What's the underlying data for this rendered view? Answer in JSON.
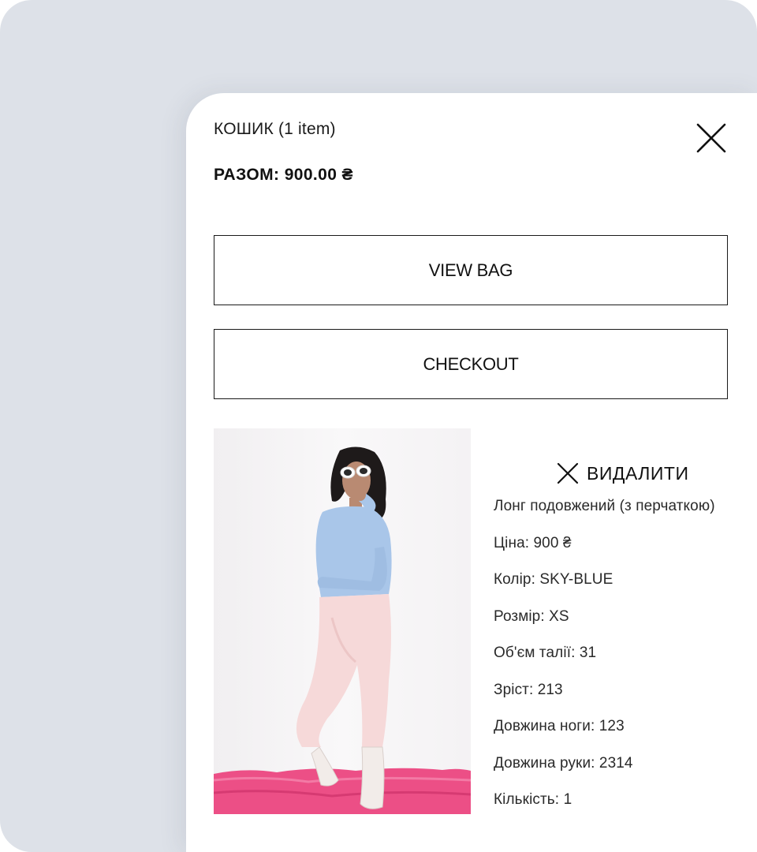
{
  "cart": {
    "title": "КОШИК (1 item)",
    "total_label": "РАЗОМ:",
    "total_value": "900.00 ₴",
    "close_icon": "close-icon"
  },
  "actions": {
    "view_bag": "VIEW BAG",
    "checkout": "CHECKOUT"
  },
  "item": {
    "remove_label": "ВИДАЛИТИ",
    "name": "Лонг подовжений (з перчаткою)",
    "price": "Ціна: 900 ₴",
    "color": "Колір: SKY-BLUE",
    "size": "Розмір: XS",
    "waist": "Об'єм талії: 31",
    "height": "Зріст: 213",
    "leg_length": "Довжина ноги: 123",
    "arm_length": "Довжина руки: 2314",
    "quantity": "Кількість: 1"
  },
  "colors": {
    "backdrop": "#dde1e8",
    "panel": "#ffffff",
    "border": "#1a1a1a",
    "top_garment": "#a9c6e9",
    "pants": "#f6d9d9",
    "rug": "#ec4f86"
  }
}
